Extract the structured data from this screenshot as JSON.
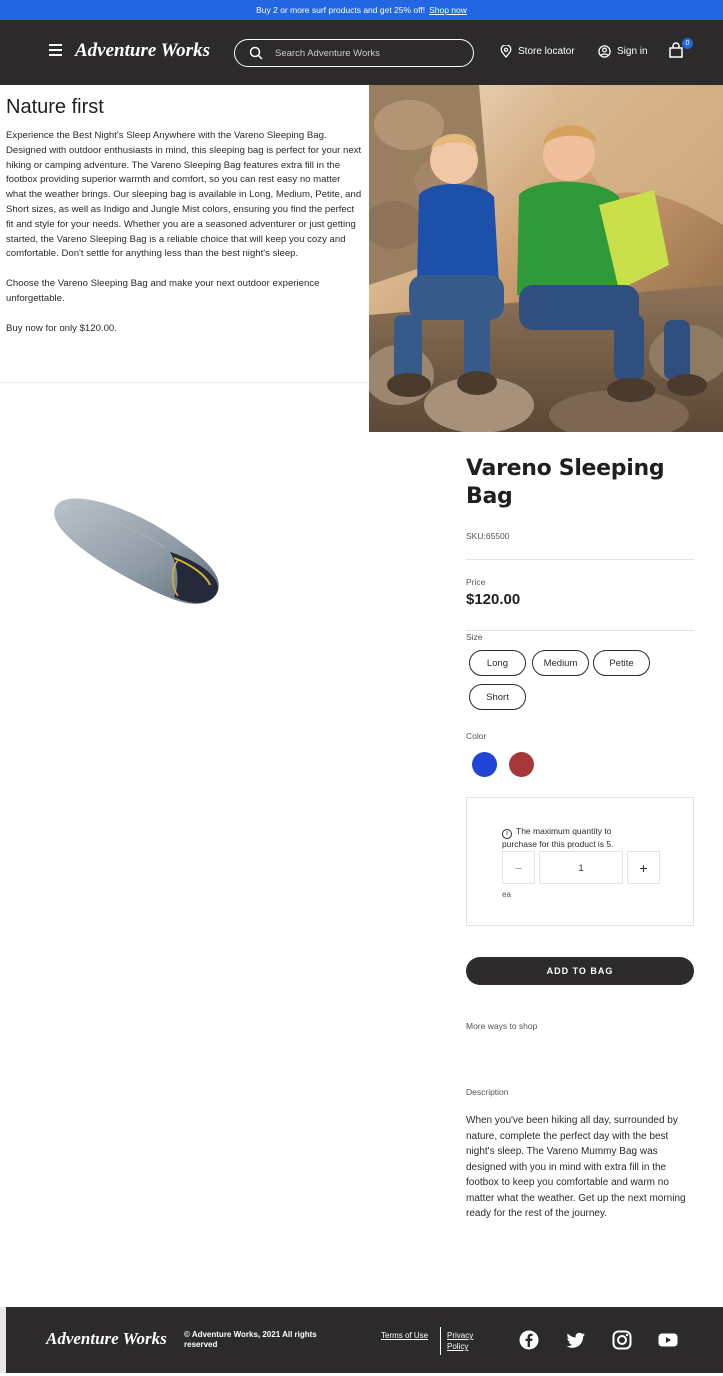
{
  "promo": {
    "text": "Buy 2 or more surf products and get 25% off!",
    "link": "Shop now"
  },
  "header": {
    "logo": "Adventure Works",
    "search_placeholder": "Search Adventure Works",
    "store_locator": "Store locator",
    "sign_in": "Sign in",
    "cart_count": "0"
  },
  "hero": {
    "title": "Nature first",
    "paragraph1": "Experience the Best Night's Sleep Anywhere with the Vareno Sleeping Bag. Designed with outdoor enthusiasts in mind, this sleeping bag is perfect for your next hiking or camping adventure. The Vareno Sleeping Bag features extra fill in the footbox providing superior warmth and comfort, so you can rest easy no matter what the weather brings. Our sleeping bag is available in Long, Medium, Petite, and Short sizes, as well as Indigo and Jungle Mist colors, ensuring you find the perfect fit and style for your needs. Whether you are a seasoned adventurer or just getting started, the Vareno Sleeping Bag is a reliable choice that will keep you cozy and comfortable. Don't settle for anything less than the best night's sleep.",
    "paragraph2": "Choose the Vareno Sleeping Bag and make your next outdoor experience unforgettable.",
    "paragraph3": "Buy now for only $120.00."
  },
  "product": {
    "title": "Vareno Sleeping Bag",
    "sku": "SKU:65500",
    "price_label": "Price",
    "price": "$120.00",
    "size_label": "Size",
    "sizes": [
      "Long",
      "Medium",
      "Petite",
      "Short"
    ],
    "color_label": "Color",
    "colors": [
      "#2244d6",
      "#a6383a"
    ],
    "quantity": {
      "info_icon": "info-icon",
      "note": "The maximum quantity to purchase for this product is 5.",
      "decrement": "−",
      "value": "1",
      "increment": "+",
      "unit": "ea"
    },
    "add_to_bag": "ADD TO BAG",
    "more_ways": "More ways to shop",
    "description_label": "Description",
    "description": "When you've been hiking all day, surrounded by nature, complete the perfect day with the best night's sleep. The Vareno Mummy Bag was designed with you in mind with extra fill in the footbox to keep you comfortable and warm no matter what the weather. Get up the next morning ready for the rest of the journey."
  },
  "footer": {
    "logo": "Adventure Works",
    "copyright": "© Adventure Works, 2021 All rights reserved",
    "terms": "Terms of Use",
    "privacy": "Privacy Policy",
    "social_icons": [
      "facebook-icon",
      "twitter-icon",
      "instagram-icon",
      "youtube-icon"
    ]
  }
}
